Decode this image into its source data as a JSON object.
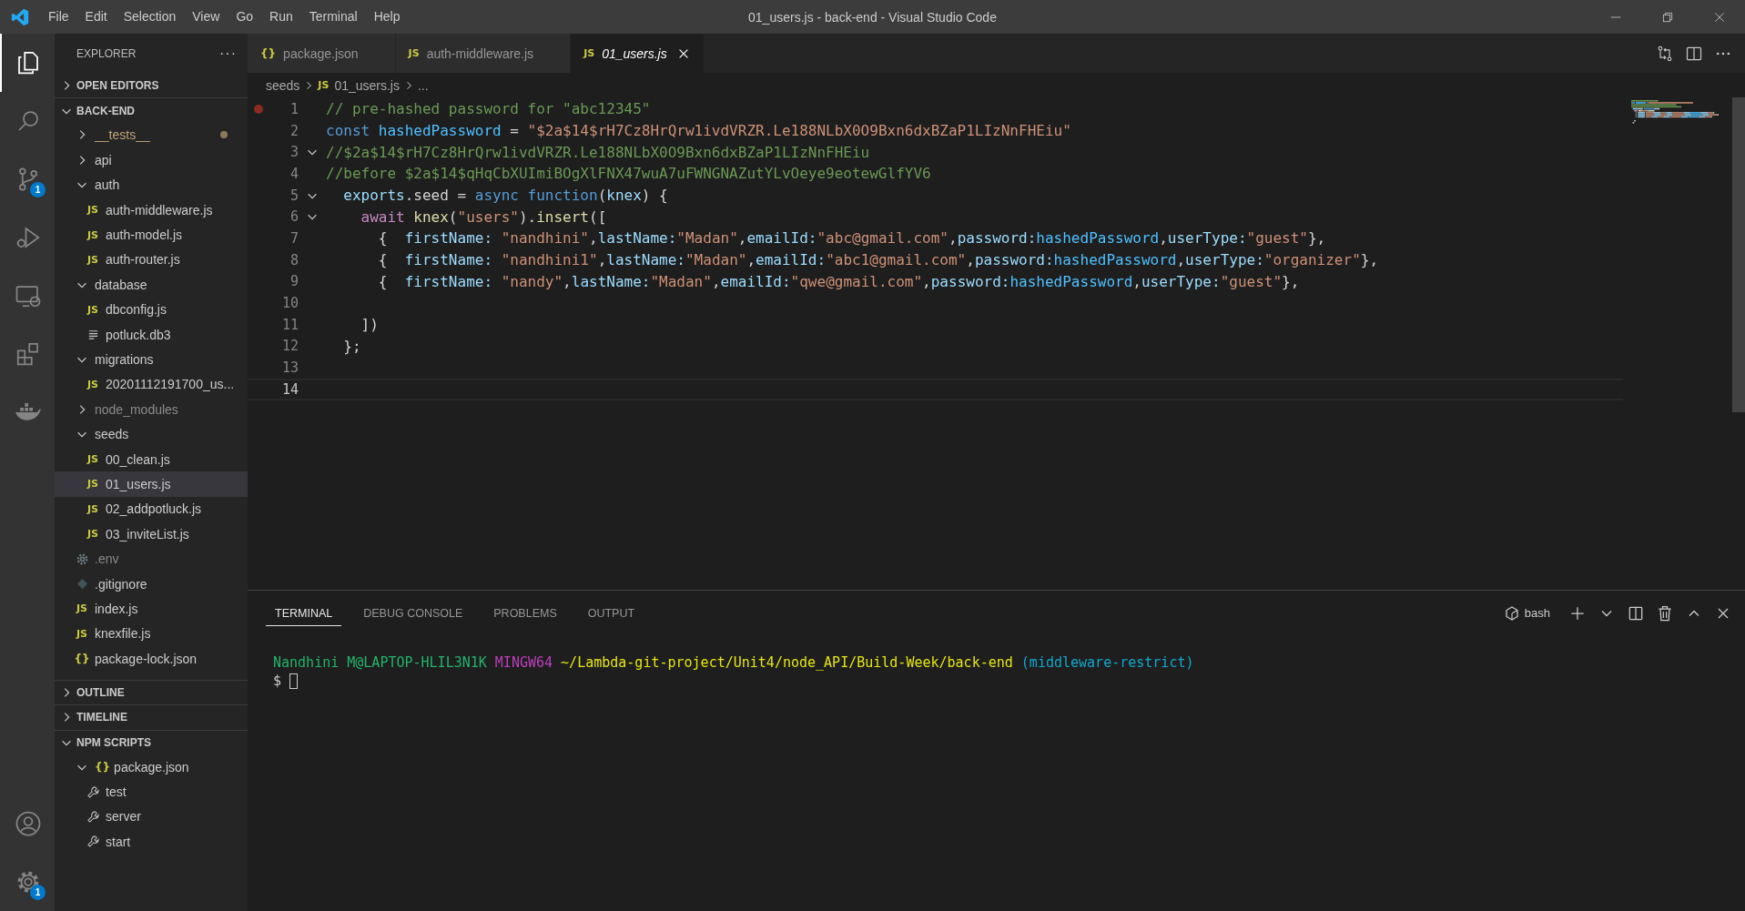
{
  "window": {
    "title": "01_users.js - back-end - Visual Studio Code"
  },
  "menu": [
    "File",
    "Edit",
    "Selection",
    "View",
    "Go",
    "Run",
    "Terminal",
    "Help"
  ],
  "activity_bar": {
    "items": [
      {
        "kind": "explorer",
        "selected": true
      },
      {
        "kind": "search",
        "selected": false
      },
      {
        "kind": "source-control",
        "selected": false,
        "badge": "1"
      },
      {
        "kind": "run",
        "selected": false
      },
      {
        "kind": "remote",
        "selected": false
      },
      {
        "kind": "extensions",
        "selected": false
      },
      {
        "kind": "docker",
        "selected": false
      }
    ],
    "bottom": [
      {
        "kind": "account"
      },
      {
        "kind": "settings",
        "badge": "1"
      }
    ]
  },
  "sidebar": {
    "title": "EXPLORER",
    "more": "···",
    "sections": [
      {
        "title": "OPEN EDITORS",
        "expanded": false
      },
      {
        "title": "BACK-END",
        "expanded": true,
        "items": [
          {
            "label": "__tests__",
            "kind": "folder",
            "expanded": false,
            "selected": false,
            "modified": true,
            "ignored": false
          },
          {
            "label": "api",
            "kind": "folder",
            "expanded": false,
            "selected": false,
            "modified": false,
            "ignored": false
          },
          {
            "label": "auth",
            "kind": "folder",
            "expanded": true,
            "selected": false,
            "modified": false,
            "ignored": false,
            "children": [
              {
                "label": "auth-middleware.js",
                "kind": "js",
                "icon": "JS",
                "selected": false,
                "modified": false,
                "ignored": false
              },
              {
                "label": "auth-model.js",
                "kind": "js",
                "icon": "JS",
                "selected": false,
                "modified": false,
                "ignored": false
              },
              {
                "label": "auth-router.js",
                "kind": "js",
                "icon": "JS",
                "selected": false,
                "modified": false,
                "ignored": false
              }
            ]
          },
          {
            "label": "database",
            "kind": "folder",
            "expanded": true,
            "selected": false,
            "modified": false,
            "ignored": false,
            "children": [
              {
                "label": "dbconfig.js",
                "kind": "js",
                "icon": "JS",
                "selected": false,
                "modified": false,
                "ignored": false
              },
              {
                "label": "potluck.db3",
                "kind": "text",
                "selected": false,
                "modified": false,
                "ignored": false
              }
            ]
          },
          {
            "label": "migrations",
            "kind": "folder",
            "expanded": true,
            "selected": false,
            "modified": false,
            "ignored": false,
            "children": [
              {
                "label": "20201112191700_us...",
                "kind": "js",
                "icon": "JS",
                "selected": false,
                "modified": false,
                "ignored": false
              }
            ]
          },
          {
            "label": "node_modules",
            "kind": "folder",
            "expanded": false,
            "selected": false,
            "modified": false,
            "ignored": true
          },
          {
            "label": "seeds",
            "kind": "folder",
            "expanded": true,
            "selected": false,
            "modified": false,
            "ignored": false,
            "children": [
              {
                "label": "00_clean.js",
                "kind": "js",
                "icon": "JS",
                "selected": false,
                "modified": false,
                "ignored": false
              },
              {
                "label": "01_users.js",
                "kind": "js",
                "icon": "JS",
                "selected": true,
                "modified": false,
                "ignored": false
              },
              {
                "label": "02_addpotluck.js",
                "kind": "js",
                "icon": "JS",
                "selected": false,
                "modified": false,
                "ignored": false
              },
              {
                "label": "03_inviteList.js",
                "kind": "js",
                "icon": "JS",
                "selected": false,
                "modified": false,
                "ignored": false
              }
            ]
          },
          {
            "label": ".env",
            "kind": "env",
            "selected": false,
            "modified": false,
            "ignored": true
          },
          {
            "label": ".gitignore",
            "kind": "git",
            "selected": false,
            "modified": false,
            "ignored": false
          },
          {
            "label": "index.js",
            "kind": "js",
            "icon": "JS",
            "selected": false,
            "modified": false,
            "ignored": false
          },
          {
            "label": "knexfile.js",
            "kind": "js",
            "icon": "JS",
            "selected": false,
            "modified": false,
            "ignored": false
          },
          {
            "label": "package-lock.json",
            "kind": "json",
            "icon": "{}",
            "selected": false,
            "modified": false,
            "ignored": false
          }
        ]
      },
      {
        "title": "OUTLINE",
        "expanded": false
      },
      {
        "title": "TIMELINE",
        "expanded": false
      },
      {
        "title": "NPM SCRIPTS",
        "expanded": true,
        "items": [
          {
            "label": "package.json",
            "kind": "package",
            "icon": "{}",
            "expanded": true,
            "selected": false,
            "modified": false,
            "ignored": false,
            "children": [
              {
                "label": "test",
                "kind": "script",
                "selected": false,
                "modified": false,
                "ignored": false
              },
              {
                "label": "server",
                "kind": "script",
                "selected": false,
                "modified": false,
                "ignored": false
              },
              {
                "label": "start",
                "kind": "script",
                "selected": false,
                "modified": false,
                "ignored": false
              }
            ]
          }
        ]
      }
    ]
  },
  "tabs": [
    {
      "label": "package.json",
      "kind": "json",
      "icon": "{}",
      "selected": false,
      "preview": false
    },
    {
      "label": "auth-middleware.js",
      "kind": "js",
      "icon": "JS",
      "selected": false,
      "preview": false
    },
    {
      "label": "01_users.js",
      "kind": "js",
      "icon": "JS",
      "selected": true,
      "preview": true
    }
  ],
  "breadcrumb": [
    {
      "label": "seeds"
    },
    {
      "label": "01_users.js",
      "icon": "JS"
    },
    {
      "label": "..."
    }
  ],
  "editor": {
    "lines": [
      {
        "number": "1",
        "breakpoint": true,
        "foldable": false,
        "current": false,
        "tokens": [
          {
            "kind": "comment",
            "text": "// pre-hashed password for \"abc12345\""
          }
        ]
      },
      {
        "number": "2",
        "breakpoint": false,
        "foldable": false,
        "current": false,
        "tokens": [
          {
            "kind": "keyword",
            "text": "const "
          },
          {
            "kind": "constant",
            "text": "hashedPassword"
          },
          {
            "kind": "plain",
            "text": " = "
          },
          {
            "kind": "string",
            "text": "\"$2a$14$rH7Cz8HrQrw1ivdVRZR.Le188NLbX0O9Bxn6dxBZaP1LIzNnFHEiu\""
          }
        ]
      },
      {
        "number": "3",
        "breakpoint": false,
        "foldable": true,
        "current": false,
        "tokens": [
          {
            "kind": "comment",
            "text": "//$2a$14$rH7Cz8HrQrw1ivdVRZR.Le188NLbX0O9Bxn6dxBZaP1LIzNnFHEiu"
          }
        ]
      },
      {
        "number": "4",
        "breakpoint": false,
        "foldable": false,
        "current": false,
        "tokens": [
          {
            "kind": "comment",
            "text": "//before $2a$14$qHqCbXUImiBOgXlFNX47wuA7uFWNGNAZutYLvOeye9eotewGlfYV6"
          }
        ]
      },
      {
        "number": "5",
        "breakpoint": false,
        "foldable": true,
        "current": false,
        "tokens": [
          {
            "kind": "variable",
            "text": "  exports"
          },
          {
            "kind": "plain",
            "text": ".seed = "
          },
          {
            "kind": "keyword",
            "text": "async function"
          },
          {
            "kind": "plain",
            "text": "("
          },
          {
            "kind": "variable",
            "text": "knex"
          },
          {
            "kind": "plain",
            "text": ") {"
          }
        ]
      },
      {
        "number": "6",
        "breakpoint": false,
        "foldable": true,
        "current": false,
        "tokens": [
          {
            "kind": "control",
            "text": "    await "
          },
          {
            "kind": "function",
            "text": "knex"
          },
          {
            "kind": "plain",
            "text": "("
          },
          {
            "kind": "string",
            "text": "\"users\""
          },
          {
            "kind": "plain",
            "text": ")."
          },
          {
            "kind": "function",
            "text": "insert"
          },
          {
            "kind": "plain",
            "text": "(["
          }
        ]
      },
      {
        "number": "7",
        "breakpoint": false,
        "foldable": false,
        "current": false,
        "tokens": [
          {
            "kind": "plain",
            "text": "      {  "
          },
          {
            "kind": "variable",
            "text": "firstName: "
          },
          {
            "kind": "string",
            "text": "\"nandhini\""
          },
          {
            "kind": "plain",
            "text": ","
          },
          {
            "kind": "variable",
            "text": "lastName:"
          },
          {
            "kind": "string",
            "text": "\"Madan\""
          },
          {
            "kind": "plain",
            "text": ","
          },
          {
            "kind": "variable",
            "text": "emailId:"
          },
          {
            "kind": "string",
            "text": "\"abc@gmail.com\""
          },
          {
            "kind": "plain",
            "text": ","
          },
          {
            "kind": "variable",
            "text": "password:"
          },
          {
            "kind": "constant",
            "text": "hashedPassword"
          },
          {
            "kind": "plain",
            "text": ","
          },
          {
            "kind": "variable",
            "text": "userType:"
          },
          {
            "kind": "string",
            "text": "\"guest\""
          },
          {
            "kind": "plain",
            "text": "},"
          }
        ]
      },
      {
        "number": "8",
        "breakpoint": false,
        "foldable": false,
        "current": false,
        "tokens": [
          {
            "kind": "plain",
            "text": "      {  "
          },
          {
            "kind": "variable",
            "text": "firstName: "
          },
          {
            "kind": "string",
            "text": "\"nandhini1\""
          },
          {
            "kind": "plain",
            "text": ","
          },
          {
            "kind": "variable",
            "text": "lastName:"
          },
          {
            "kind": "string",
            "text": "\"Madan\""
          },
          {
            "kind": "plain",
            "text": ","
          },
          {
            "kind": "variable",
            "text": "emailId:"
          },
          {
            "kind": "string",
            "text": "\"abc1@gmail.com\""
          },
          {
            "kind": "plain",
            "text": ","
          },
          {
            "kind": "variable",
            "text": "password:"
          },
          {
            "kind": "constant",
            "text": "hashedPassword"
          },
          {
            "kind": "plain",
            "text": ","
          },
          {
            "kind": "variable",
            "text": "userType:"
          },
          {
            "kind": "string",
            "text": "\"organizer\""
          },
          {
            "kind": "plain",
            "text": "},"
          }
        ]
      },
      {
        "number": "9",
        "breakpoint": false,
        "foldable": false,
        "current": false,
        "tokens": [
          {
            "kind": "plain",
            "text": "      {  "
          },
          {
            "kind": "variable",
            "text": "firstName: "
          },
          {
            "kind": "string",
            "text": "\"nandy\""
          },
          {
            "kind": "plain",
            "text": ","
          },
          {
            "kind": "variable",
            "text": "lastName:"
          },
          {
            "kind": "string",
            "text": "\"Madan\""
          },
          {
            "kind": "plain",
            "text": ","
          },
          {
            "kind": "variable",
            "text": "emailId:"
          },
          {
            "kind": "string",
            "text": "\"qwe@gmail.com\""
          },
          {
            "kind": "plain",
            "text": ","
          },
          {
            "kind": "variable",
            "text": "password:"
          },
          {
            "kind": "constant",
            "text": "hashedPassword"
          },
          {
            "kind": "plain",
            "text": ","
          },
          {
            "kind": "variable",
            "text": "userType:"
          },
          {
            "kind": "string",
            "text": "\"guest\""
          },
          {
            "kind": "plain",
            "text": "},"
          }
        ]
      },
      {
        "number": "10",
        "breakpoint": false,
        "foldable": false,
        "current": false
      },
      {
        "number": "11",
        "breakpoint": false,
        "foldable": false,
        "current": false,
        "tokens": [
          {
            "kind": "plain",
            "text": "    ])"
          }
        ]
      },
      {
        "number": "12",
        "breakpoint": false,
        "foldable": false,
        "current": false,
        "tokens": [
          {
            "kind": "plain",
            "text": "  };"
          }
        ]
      },
      {
        "number": "13",
        "breakpoint": false,
        "foldable": false,
        "current": false
      },
      {
        "number": "14",
        "breakpoint": false,
        "foldable": false,
        "current": true
      }
    ]
  },
  "panel": {
    "tabs": [
      {
        "label": "TERMINAL",
        "selected": true
      },
      {
        "label": "DEBUG CONSOLE",
        "selected": false
      },
      {
        "label": "PROBLEMS",
        "selected": false
      },
      {
        "label": "OUTPUT",
        "selected": false
      }
    ],
    "terminal_name": "bash",
    "lines": [
      {
        "segments": [
          {
            "kind": "user",
            "text": "Nandhini M@LAPTOP-HLIL3N1K "
          },
          {
            "kind": "system",
            "text": "MINGW64 "
          },
          {
            "kind": "path",
            "text": "~/Lambda-git-project/Unit4/node_API/Build-Week/back-end "
          },
          {
            "kind": "branch",
            "text": "(middleware-restrict)"
          }
        ],
        "cursor": false
      },
      {
        "segments": [
          {
            "kind": "plain",
            "text": "$"
          }
        ],
        "cursor": true
      }
    ]
  }
}
